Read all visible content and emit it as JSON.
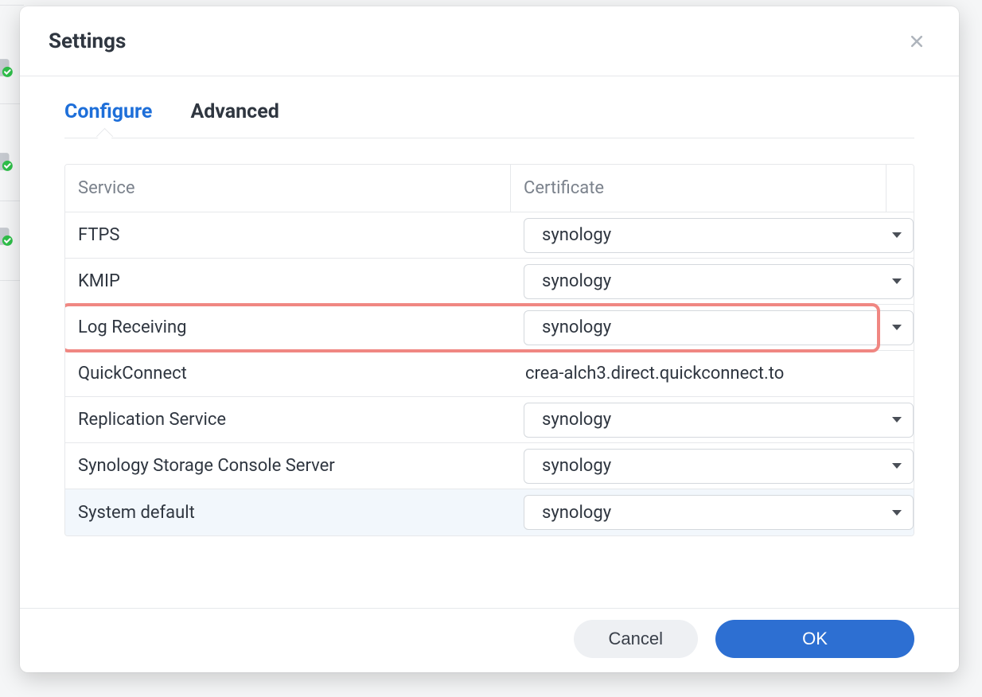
{
  "modal": {
    "title": "Settings",
    "tabs": [
      {
        "label": "Configure",
        "active": true
      },
      {
        "label": "Advanced",
        "active": false
      }
    ],
    "footer": {
      "cancel": "Cancel",
      "ok": "OK"
    }
  },
  "table": {
    "headers": {
      "service": "Service",
      "certificate": "Certificate"
    },
    "rows": [
      {
        "service": "FTPS",
        "type": "select",
        "value": "synology",
        "highlighted": false
      },
      {
        "service": "KMIP",
        "type": "select",
        "value": "synology",
        "highlighted": false
      },
      {
        "service": "Log Receiving",
        "type": "select",
        "value": "synology",
        "highlighted": true
      },
      {
        "service": "QuickConnect",
        "type": "text",
        "value": "crea-alch3.direct.quickconnect.to",
        "highlighted": false
      },
      {
        "service": "Replication Service",
        "type": "select",
        "value": "synology",
        "highlighted": false
      },
      {
        "service": "Synology Storage Console Server",
        "type": "select",
        "value": "synology",
        "highlighted": false
      },
      {
        "service": "System default",
        "type": "select",
        "value": "synology",
        "highlighted": false,
        "alt": true
      }
    ]
  }
}
